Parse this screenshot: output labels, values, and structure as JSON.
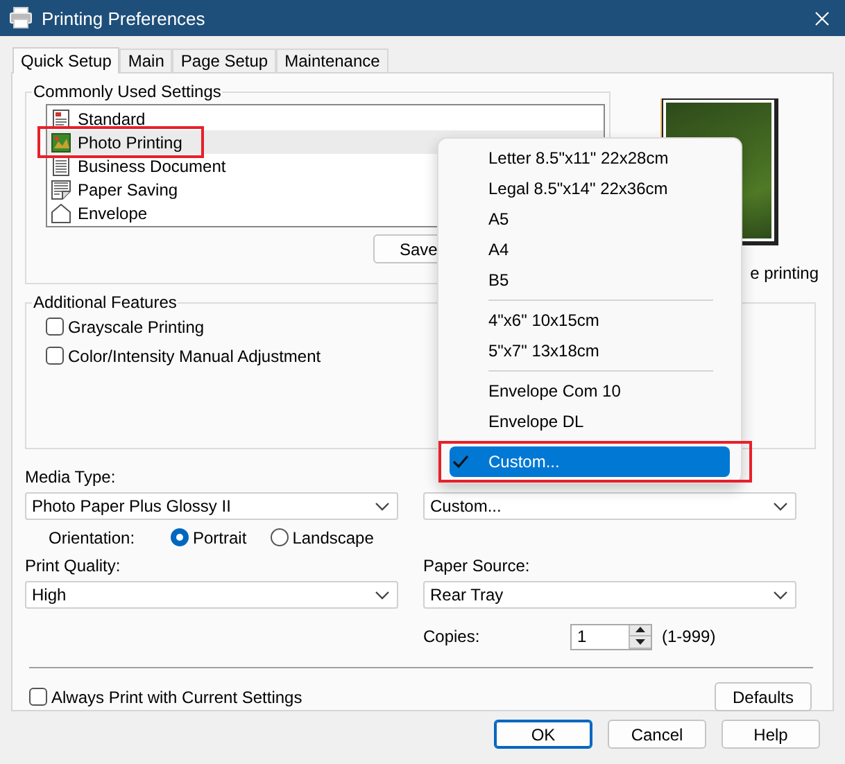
{
  "window": {
    "title": "Printing Preferences"
  },
  "tabs": [
    {
      "label": "Quick Setup",
      "selected": true
    },
    {
      "label": "Main",
      "selected": false
    },
    {
      "label": "Page Setup",
      "selected": false
    },
    {
      "label": "Maintenance",
      "selected": false
    }
  ],
  "commonly_used": {
    "title": "Commonly Used Settings",
    "save_button": "Save",
    "items": [
      {
        "label": "Standard",
        "kind": "standard",
        "selected": false,
        "highlighted": false
      },
      {
        "label": "Photo Printing",
        "kind": "photo",
        "selected": true,
        "highlighted": true
      },
      {
        "label": "Business Document",
        "kind": "business",
        "selected": false,
        "highlighted": false
      },
      {
        "label": "Paper Saving",
        "kind": "saving",
        "selected": false,
        "highlighted": false
      },
      {
        "label": "Envelope",
        "kind": "envelope",
        "selected": false,
        "highlighted": false
      }
    ]
  },
  "preview": {
    "caption": "e printing"
  },
  "additional_features": {
    "title": "Additional Features",
    "options": [
      {
        "label": "Grayscale Printing",
        "checked": false
      },
      {
        "label": "Color/Intensity Manual Adjustment",
        "checked": false
      }
    ]
  },
  "media_type": {
    "label": "Media Type:",
    "value": "Photo Paper Plus Glossy II"
  },
  "paper_size": {
    "value": "Custom...",
    "menu_groups": [
      [
        {
          "label": "Letter 8.5\"x11\" 22x28cm",
          "selected": false,
          "highlighted": false
        },
        {
          "label": "Legal 8.5\"x14\" 22x36cm",
          "selected": false,
          "highlighted": false
        },
        {
          "label": "A5",
          "selected": false,
          "highlighted": false
        },
        {
          "label": "A4",
          "selected": false,
          "highlighted": false
        },
        {
          "label": "B5",
          "selected": false,
          "highlighted": false
        }
      ],
      [
        {
          "label": "4\"x6\" 10x15cm",
          "selected": false,
          "highlighted": false
        },
        {
          "label": "5\"x7\" 13x18cm",
          "selected": false,
          "highlighted": false
        }
      ],
      [
        {
          "label": "Envelope Com 10",
          "selected": false,
          "highlighted": false
        },
        {
          "label": "Envelope DL",
          "selected": false,
          "highlighted": false
        }
      ],
      [
        {
          "label": "Custom...",
          "selected": true,
          "highlighted": true
        }
      ]
    ]
  },
  "orientation": {
    "label": "Orientation:",
    "options": [
      {
        "label": "Portrait",
        "selected": true
      },
      {
        "label": "Landscape",
        "selected": false
      }
    ]
  },
  "print_quality": {
    "label": "Print Quality:",
    "value": "High"
  },
  "paper_source": {
    "label": "Paper Source:",
    "value": "Rear Tray"
  },
  "copies": {
    "label": "Copies:",
    "value": "1",
    "range": "(1-999)"
  },
  "always_print": {
    "label": "Always Print with Current Settings",
    "checked": false
  },
  "defaults_button": "Defaults",
  "buttons": [
    {
      "label": "OK",
      "default": true
    },
    {
      "label": "Cancel",
      "default": false
    },
    {
      "label": "Help",
      "default": false
    }
  ]
}
